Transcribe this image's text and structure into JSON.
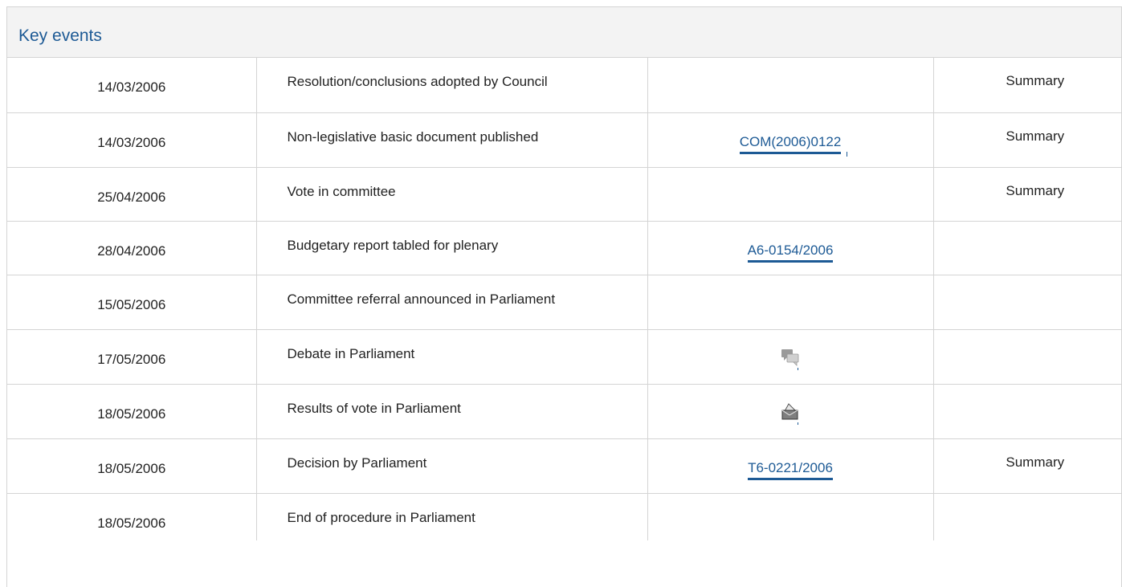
{
  "section": {
    "title": "Key events"
  },
  "icons": {
    "debate": "speech-bubbles-icon",
    "vote": "ballot-box-icon"
  },
  "colors": {
    "link": "#1d5a95",
    "header_bg": "#f3f3f3",
    "border": "#d4d4d4"
  },
  "events": [
    {
      "date": "14/03/2006",
      "event": "Resolution/conclusions adopted by Council",
      "doc": "",
      "summary": "Summary"
    },
    {
      "date": "14/03/2006",
      "event": "Non-legislative basic document published",
      "doc": "COM(2006)0122",
      "summary": "Summary"
    },
    {
      "date": "25/04/2006",
      "event": "Vote in committee",
      "doc": "",
      "summary": "Summary"
    },
    {
      "date": "28/04/2006",
      "event": "Budgetary report tabled for plenary",
      "doc": "A6-0154/2006",
      "summary": ""
    },
    {
      "date": "15/05/2006",
      "event": "Committee referral announced in Parliament",
      "doc": "",
      "summary": ""
    },
    {
      "date": "17/05/2006",
      "event": "Debate in Parliament",
      "doc": "",
      "summary": ""
    },
    {
      "date": "18/05/2006",
      "event": "Results of vote in Parliament",
      "doc": "",
      "summary": ""
    },
    {
      "date": "18/05/2006",
      "event": "Decision by Parliament",
      "doc": "T6-0221/2006",
      "summary": "Summary"
    },
    {
      "date": "18/05/2006",
      "event": "End of procedure in Parliament",
      "doc": "",
      "summary": ""
    }
  ]
}
